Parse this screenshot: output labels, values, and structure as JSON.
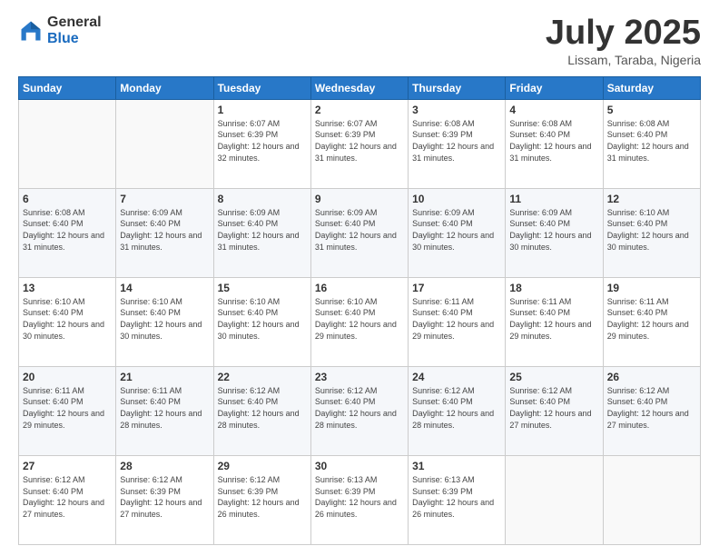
{
  "logo": {
    "general": "General",
    "blue": "Blue"
  },
  "header": {
    "month": "July 2025",
    "location": "Lissam, Taraba, Nigeria"
  },
  "weekdays": [
    "Sunday",
    "Monday",
    "Tuesday",
    "Wednesday",
    "Thursday",
    "Friday",
    "Saturday"
  ],
  "weeks": [
    [
      {
        "day": "",
        "info": ""
      },
      {
        "day": "",
        "info": ""
      },
      {
        "day": "1",
        "info": "Sunrise: 6:07 AM\nSunset: 6:39 PM\nDaylight: 12 hours and 32 minutes."
      },
      {
        "day": "2",
        "info": "Sunrise: 6:07 AM\nSunset: 6:39 PM\nDaylight: 12 hours and 31 minutes."
      },
      {
        "day": "3",
        "info": "Sunrise: 6:08 AM\nSunset: 6:39 PM\nDaylight: 12 hours and 31 minutes."
      },
      {
        "day": "4",
        "info": "Sunrise: 6:08 AM\nSunset: 6:40 PM\nDaylight: 12 hours and 31 minutes."
      },
      {
        "day": "5",
        "info": "Sunrise: 6:08 AM\nSunset: 6:40 PM\nDaylight: 12 hours and 31 minutes."
      }
    ],
    [
      {
        "day": "6",
        "info": "Sunrise: 6:08 AM\nSunset: 6:40 PM\nDaylight: 12 hours and 31 minutes."
      },
      {
        "day": "7",
        "info": "Sunrise: 6:09 AM\nSunset: 6:40 PM\nDaylight: 12 hours and 31 minutes."
      },
      {
        "day": "8",
        "info": "Sunrise: 6:09 AM\nSunset: 6:40 PM\nDaylight: 12 hours and 31 minutes."
      },
      {
        "day": "9",
        "info": "Sunrise: 6:09 AM\nSunset: 6:40 PM\nDaylight: 12 hours and 31 minutes."
      },
      {
        "day": "10",
        "info": "Sunrise: 6:09 AM\nSunset: 6:40 PM\nDaylight: 12 hours and 30 minutes."
      },
      {
        "day": "11",
        "info": "Sunrise: 6:09 AM\nSunset: 6:40 PM\nDaylight: 12 hours and 30 minutes."
      },
      {
        "day": "12",
        "info": "Sunrise: 6:10 AM\nSunset: 6:40 PM\nDaylight: 12 hours and 30 minutes."
      }
    ],
    [
      {
        "day": "13",
        "info": "Sunrise: 6:10 AM\nSunset: 6:40 PM\nDaylight: 12 hours and 30 minutes."
      },
      {
        "day": "14",
        "info": "Sunrise: 6:10 AM\nSunset: 6:40 PM\nDaylight: 12 hours and 30 minutes."
      },
      {
        "day": "15",
        "info": "Sunrise: 6:10 AM\nSunset: 6:40 PM\nDaylight: 12 hours and 30 minutes."
      },
      {
        "day": "16",
        "info": "Sunrise: 6:10 AM\nSunset: 6:40 PM\nDaylight: 12 hours and 29 minutes."
      },
      {
        "day": "17",
        "info": "Sunrise: 6:11 AM\nSunset: 6:40 PM\nDaylight: 12 hours and 29 minutes."
      },
      {
        "day": "18",
        "info": "Sunrise: 6:11 AM\nSunset: 6:40 PM\nDaylight: 12 hours and 29 minutes."
      },
      {
        "day": "19",
        "info": "Sunrise: 6:11 AM\nSunset: 6:40 PM\nDaylight: 12 hours and 29 minutes."
      }
    ],
    [
      {
        "day": "20",
        "info": "Sunrise: 6:11 AM\nSunset: 6:40 PM\nDaylight: 12 hours and 29 minutes."
      },
      {
        "day": "21",
        "info": "Sunrise: 6:11 AM\nSunset: 6:40 PM\nDaylight: 12 hours and 28 minutes."
      },
      {
        "day": "22",
        "info": "Sunrise: 6:12 AM\nSunset: 6:40 PM\nDaylight: 12 hours and 28 minutes."
      },
      {
        "day": "23",
        "info": "Sunrise: 6:12 AM\nSunset: 6:40 PM\nDaylight: 12 hours and 28 minutes."
      },
      {
        "day": "24",
        "info": "Sunrise: 6:12 AM\nSunset: 6:40 PM\nDaylight: 12 hours and 28 minutes."
      },
      {
        "day": "25",
        "info": "Sunrise: 6:12 AM\nSunset: 6:40 PM\nDaylight: 12 hours and 27 minutes."
      },
      {
        "day": "26",
        "info": "Sunrise: 6:12 AM\nSunset: 6:40 PM\nDaylight: 12 hours and 27 minutes."
      }
    ],
    [
      {
        "day": "27",
        "info": "Sunrise: 6:12 AM\nSunset: 6:40 PM\nDaylight: 12 hours and 27 minutes."
      },
      {
        "day": "28",
        "info": "Sunrise: 6:12 AM\nSunset: 6:39 PM\nDaylight: 12 hours and 27 minutes."
      },
      {
        "day": "29",
        "info": "Sunrise: 6:12 AM\nSunset: 6:39 PM\nDaylight: 12 hours and 26 minutes."
      },
      {
        "day": "30",
        "info": "Sunrise: 6:13 AM\nSunset: 6:39 PM\nDaylight: 12 hours and 26 minutes."
      },
      {
        "day": "31",
        "info": "Sunrise: 6:13 AM\nSunset: 6:39 PM\nDaylight: 12 hours and 26 minutes."
      },
      {
        "day": "",
        "info": ""
      },
      {
        "day": "",
        "info": ""
      }
    ]
  ]
}
